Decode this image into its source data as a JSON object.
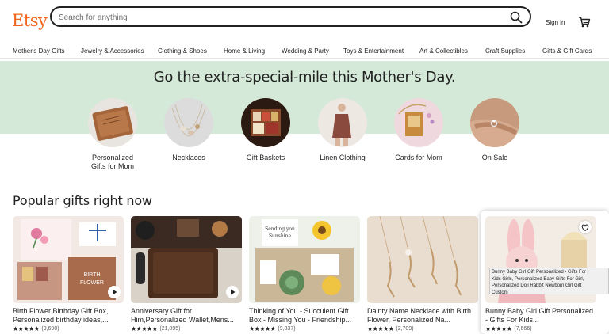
{
  "header": {
    "logo": "Etsy",
    "search_placeholder": "Search for anything",
    "signin_label": "Sign in"
  },
  "nav": {
    "items": [
      "Mother's Day Gifts",
      "Jewelry & Accessories",
      "Clothing & Shoes",
      "Home & Living",
      "Wedding & Party",
      "Toys & Entertainment",
      "Art & Collectibles",
      "Craft Supplies",
      "Gifts & Gift Cards"
    ]
  },
  "hero": {
    "title": "Go the extra-special-mile this Mother's Day."
  },
  "categories": [
    {
      "label": "Personalized\nGifts for Mom"
    },
    {
      "label": "Necklaces"
    },
    {
      "label": "Gift Baskets"
    },
    {
      "label": "Linen Clothing"
    },
    {
      "label": "Cards for Mom"
    },
    {
      "label": "On Sale"
    }
  ],
  "popular": {
    "title": "Popular gifts right now",
    "items": [
      {
        "title": "Birth Flower Birthday Gift Box, Personalized birthday ideas,...",
        "stars": "★★★★★",
        "count": "(9,690)"
      },
      {
        "title": "Anniversary Gift for Him,Personalized Wallet,Mens...",
        "stars": "★★★★★",
        "count": "(21,895)"
      },
      {
        "title": "Thinking of You - Succulent Gift Box - Missing You - Friendship...",
        "stars": "★★★★★",
        "count": "(9,837)"
      },
      {
        "title": "Dainty Name Necklace with Birth Flower, Personalized Na...",
        "stars": "★★★★★",
        "count": "(2,709)"
      },
      {
        "title": "Bunny Baby Girl Gift Personalized - Gifts For Kids...",
        "stars": "★★★★★",
        "count": "(7,666)"
      }
    ],
    "tooltip": "Bunny Baby Girl Gift Personalized - Gifts For\nKids Girls, Personalized Baby Gifts For Girl,\nPersonalized Doll Rabbit Newborn Girl Gift\nCustom"
  },
  "colors": {
    "brand": "#F1641E",
    "hero_bg": "#d4e9d7"
  },
  "icons": {
    "search": "search-icon",
    "cart": "cart-icon",
    "play": "play-icon",
    "favorite": "heart-icon"
  }
}
